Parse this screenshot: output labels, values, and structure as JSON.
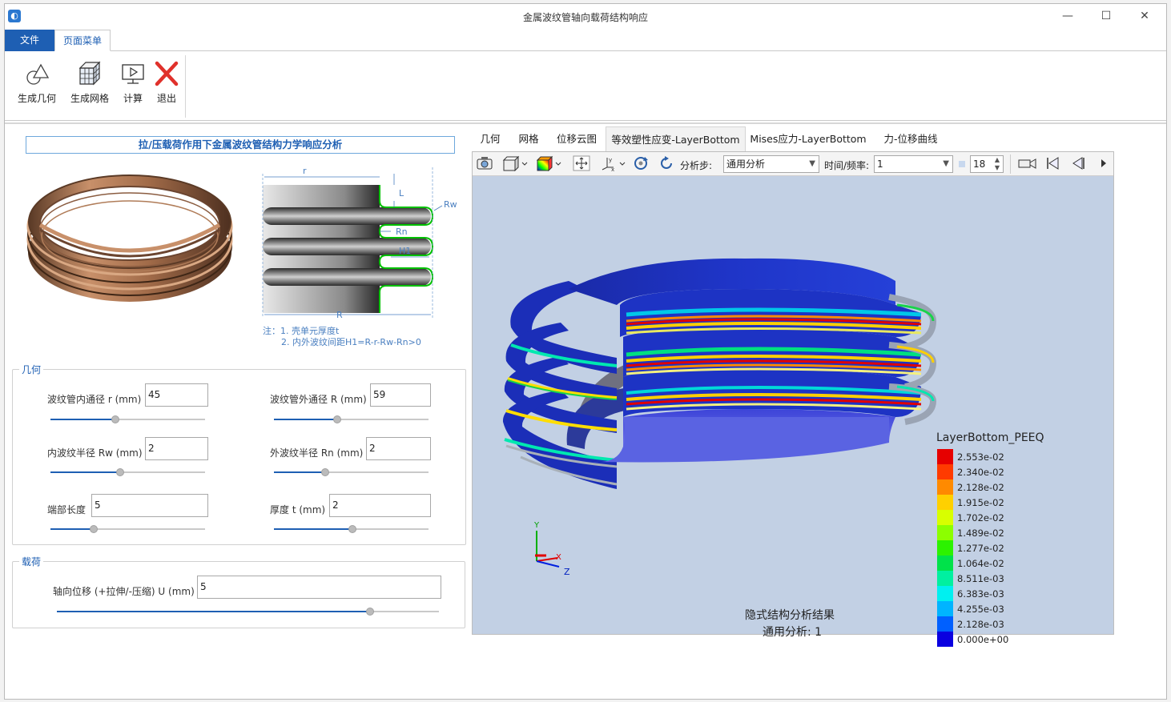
{
  "window": {
    "title": "金属波纹管轴向载荷结构响应",
    "app_icon": "app-logo-icon",
    "controls": {
      "minimize": "—",
      "maximize": "☐",
      "close": "✕"
    }
  },
  "menu": {
    "file": "文件",
    "page_menu": "页面菜单"
  },
  "ribbon": {
    "gen_geometry": "生成几何",
    "gen_mesh": "生成网格",
    "compute": "计算",
    "exit": "退出"
  },
  "panel": {
    "title": "拉/压载荷作用下金属波纹管结构力学响应分析",
    "schematic_labels": {
      "r": "r",
      "L": "L",
      "Rw": "Rw",
      "Rn": "Rn",
      "H1": "H1",
      "R": "R"
    },
    "note1": "注：1. 壳单元厚度t",
    "note2": "2. 内外波纹间距H1=R-r-Rw-Rn>0"
  },
  "geometry": {
    "group_label": "几何",
    "fields": {
      "inner_diam": {
        "label": "波纹管内通径 r (mm)",
        "value": "45",
        "slider": 0.42
      },
      "outer_diam": {
        "label": "波纹管外通径 R (mm)",
        "value": "59",
        "slider": 0.41
      },
      "inner_radius": {
        "label": "内波纹半径 Rw (mm)",
        "value": "2",
        "slider": 0.45
      },
      "outer_radius": {
        "label": "外波纹半径 Rn (mm)",
        "value": "2",
        "slider": 0.33
      },
      "end_length": {
        "label": "端部长度",
        "value": "5",
        "slider": 0.28
      },
      "thickness": {
        "label": "厚度 t (mm)",
        "value": "2",
        "slider": 0.51
      }
    }
  },
  "load": {
    "group_label": "载荷",
    "field": {
      "label": "轴向位移 (+拉伸/-压缩) U (mm)",
      "value": "5",
      "slider": 0.82
    }
  },
  "tabs": [
    "几何",
    "网格",
    "位移云图",
    "等效塑性应变-LayerBottom",
    "Mises应力-LayerBottom",
    "力-位移曲线"
  ],
  "active_tab": 3,
  "viewer": {
    "step_label": "分析步:",
    "step_value": "通用分析",
    "time_label": "时间/频率:",
    "time_value": "1",
    "frame_value": "18",
    "legend_title": "LayerBottom_PEEQ",
    "legend": [
      {
        "value": "2.553e-02",
        "color": "#e60000"
      },
      {
        "value": "2.340e-02",
        "color": "#ff3b00"
      },
      {
        "value": "2.128e-02",
        "color": "#ff8a00"
      },
      {
        "value": "1.915e-02",
        "color": "#ffd000"
      },
      {
        "value": "1.702e-02",
        "color": "#d8ff00"
      },
      {
        "value": "1.489e-02",
        "color": "#8cff00"
      },
      {
        "value": "1.277e-02",
        "color": "#2cf200"
      },
      {
        "value": "1.064e-02",
        "color": "#00e24a"
      },
      {
        "value": "8.511e-03",
        "color": "#00f0a0"
      },
      {
        "value": "6.383e-03",
        "color": "#00f0f0"
      },
      {
        "value": "4.255e-03",
        "color": "#00b4ff"
      },
      {
        "value": "2.128e-03",
        "color": "#0060ff"
      },
      {
        "value": "0.000e+00",
        "color": "#0a00e0"
      }
    ],
    "caption_line1": "隐式结构分析结果",
    "caption_line2": "通用分析: 1",
    "axes": {
      "y": "Y",
      "x": "X",
      "z": "Z"
    }
  }
}
